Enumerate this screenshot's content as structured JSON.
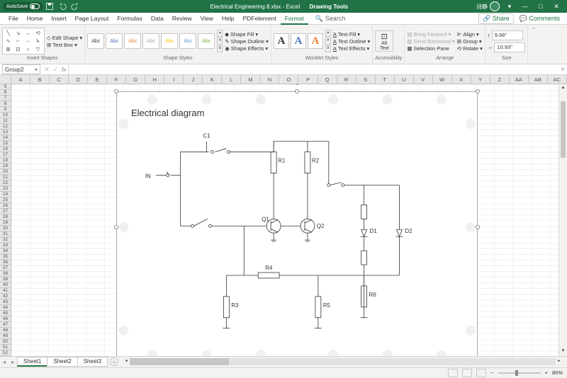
{
  "titlebar": {
    "autosave_label": "AutoSave",
    "filename": "Electrical Engineering 8.xlsx - Excel",
    "context_tab": "Drawing Tools",
    "user": "诗静"
  },
  "tabs": {
    "list": [
      "File",
      "Home",
      "Insert",
      "Page Layout",
      "Formulas",
      "Data",
      "Review",
      "View",
      "Help",
      "PDFelement",
      "Format"
    ],
    "active": "Format",
    "search_label": "Search",
    "share_label": "Share",
    "comments_label": "Comments"
  },
  "ribbon": {
    "insert_shapes": {
      "edit_shape": "Edit Shape",
      "text_box": "Text Box",
      "label": "Insert Shapes"
    },
    "shape_styles": {
      "preset_text": "Abc",
      "fill": "Shape Fill",
      "outline": "Shape Outline",
      "effects": "Shape Effects",
      "label": "Shape Styles"
    },
    "wordart": {
      "text_fill": "Text Fill",
      "text_outline": "Text Outline",
      "text_effects": "Text Effects",
      "label": "WordArt Styles"
    },
    "accessibility": {
      "alt_text": "Alt\nText",
      "label": "Accessibility"
    },
    "arrange": {
      "bring_forward": "Bring Forward",
      "send_backward": "Send Backward",
      "selection_pane": "Selection Pane",
      "align": "Align",
      "group": "Group",
      "rotate": "Rotate",
      "label": "Arrange"
    },
    "size": {
      "height": "9.66\"",
      "width": "10.93\"",
      "label": "Size"
    }
  },
  "namebox": {
    "value": "Group2"
  },
  "columns": [
    "A",
    "B",
    "C",
    "D",
    "E",
    "F",
    "G",
    "H",
    "I",
    "J",
    "K",
    "L",
    "M",
    "N",
    "O",
    "P",
    "Q",
    "R",
    "S",
    "T",
    "U",
    "V",
    "W",
    "X",
    "Y",
    "Z",
    "AA",
    "AB",
    "AC"
  ],
  "row_start": 5,
  "row_end": 52,
  "diagram": {
    "title": "Electrical diagram",
    "labels": {
      "in": "IN",
      "c1": "C1",
      "r1": "R1",
      "r2": "R2",
      "r3": "R3",
      "r4": "R4",
      "r5": "R5",
      "r6": "R6",
      "q1": "Q1",
      "q2": "Q2",
      "d1": "D1",
      "d2": "D2"
    }
  },
  "sheet_tabs": {
    "list": [
      "Sheet1",
      "Sheet2",
      "Sheet3"
    ],
    "active": "Sheet1"
  },
  "statusbar": {
    "zoom": "80%"
  }
}
